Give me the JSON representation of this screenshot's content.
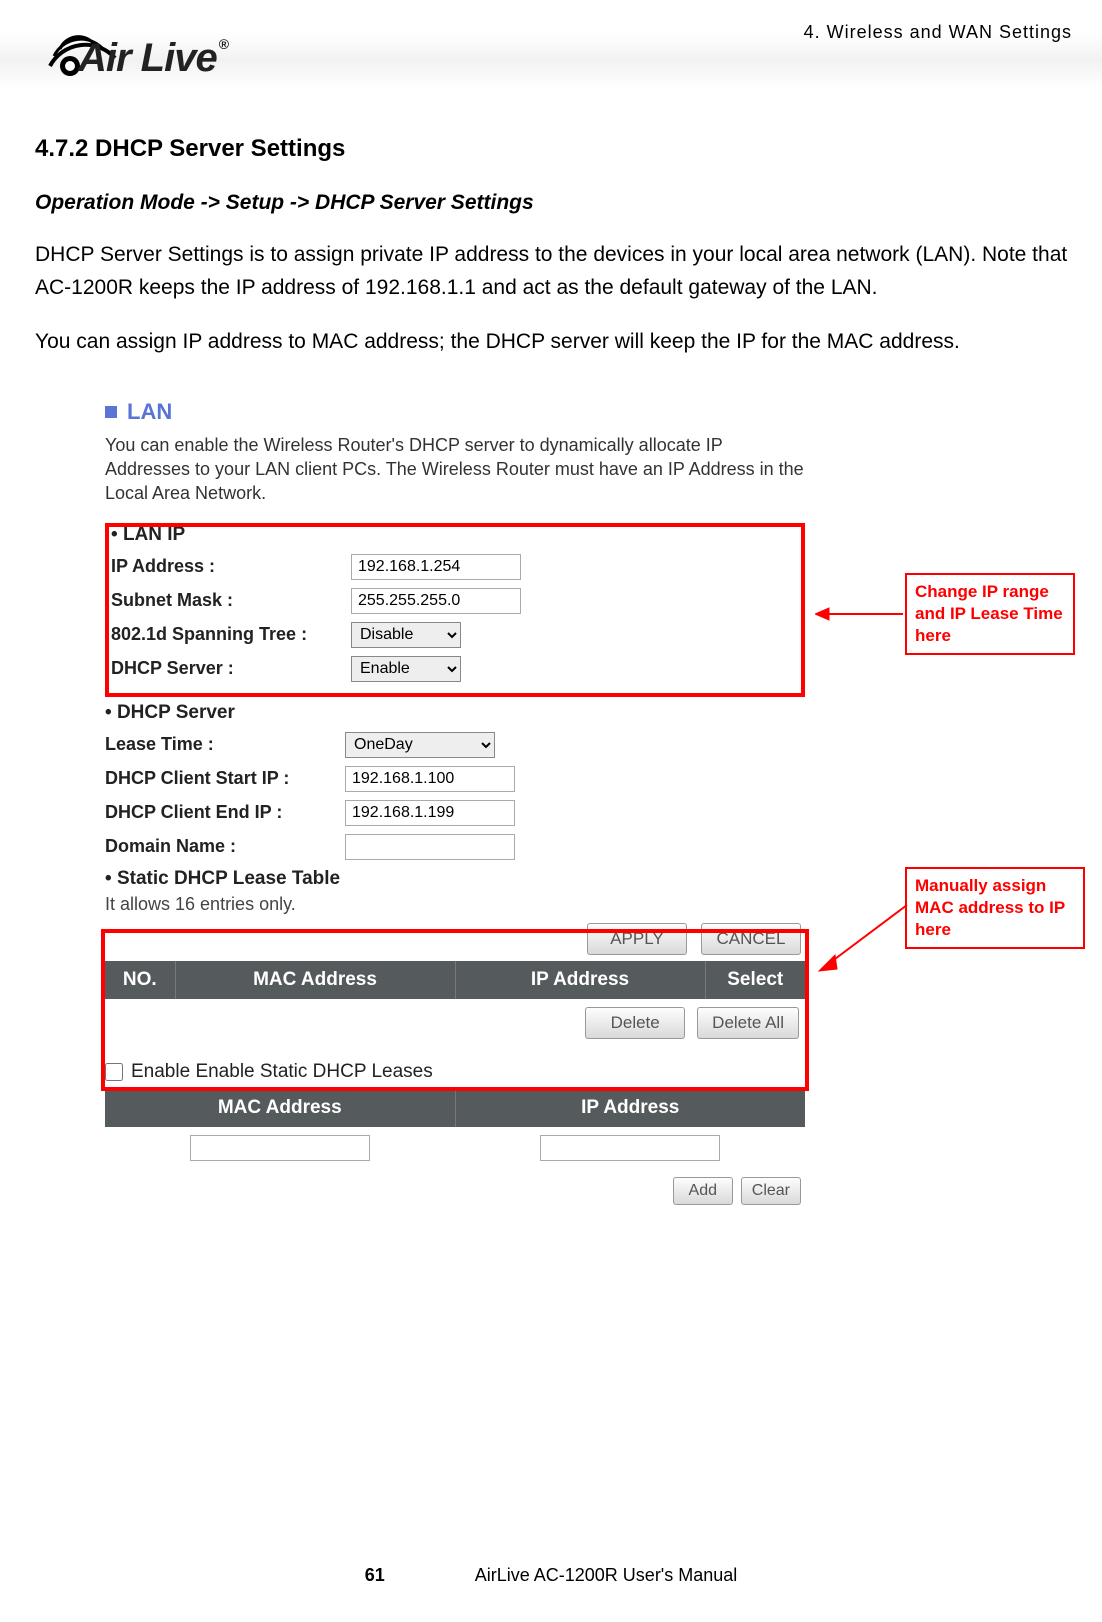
{
  "header": {
    "chapter": "4.  Wireless  and  WAN  Settings",
    "logo_text": "Air Live",
    "logo_reg": "®"
  },
  "section": {
    "title": "4.7.2 DHCP Server Settings",
    "breadcrumb": "Operation Mode -> Setup -> DHCP Server Settings",
    "para1": "DHCP Server Settings is to assign private IP address to the devices in your local area network (LAN). Note that AC-1200R keeps the IP address of 192.168.1.1 and act as the default gateway of the LAN.",
    "para2": "You can assign IP address to MAC address; the DHCP server will keep the IP for the MAC address."
  },
  "panel": {
    "lan_label": "LAN",
    "intro": "You can enable the Wireless Router's DHCP server to dynamically allocate IP Addresses to your LAN client PCs. The Wireless Router must have an IP Address in the Local Area Network.",
    "lanip_header": "LAN IP",
    "labels": {
      "ip": "IP Address :",
      "mask": "Subnet Mask :",
      "spanning": "802.1d Spanning Tree :",
      "dhcp": "DHCP Server :",
      "lease": "Lease Time :",
      "start": "DHCP Client Start IP :",
      "end": "DHCP Client End IP :",
      "domain": "Domain Name :"
    },
    "values": {
      "ip": "192.168.1.254",
      "mask": "255.255.255.0",
      "spanning": "Disable",
      "dhcp": "Enable",
      "lease": "OneDay",
      "start": "192.168.1.100",
      "end": "192.168.1.199",
      "domain": ""
    },
    "dhcp_header": "DHCP Server",
    "static_header": "Static DHCP Lease Table",
    "static_note": "It allows 16 entries only.",
    "buttons": {
      "apply": "APPLY",
      "cancel": "CANCEL",
      "delete": "Delete",
      "delete_all": "Delete All",
      "add": "Add",
      "clear": "Clear"
    },
    "table1_headers": [
      "NO.",
      "MAC Address",
      "IP Address",
      "Select"
    ],
    "enable_label": "Enable Enable Static DHCP Leases",
    "table2_headers": [
      "MAC Address",
      "IP Address"
    ]
  },
  "callouts": {
    "c1": "Change IP range and IP Lease Time here",
    "c2": "Manually assign MAC address to IP here"
  },
  "footer": {
    "page": "61",
    "manual": "AirLive AC-1200R User's Manual"
  }
}
